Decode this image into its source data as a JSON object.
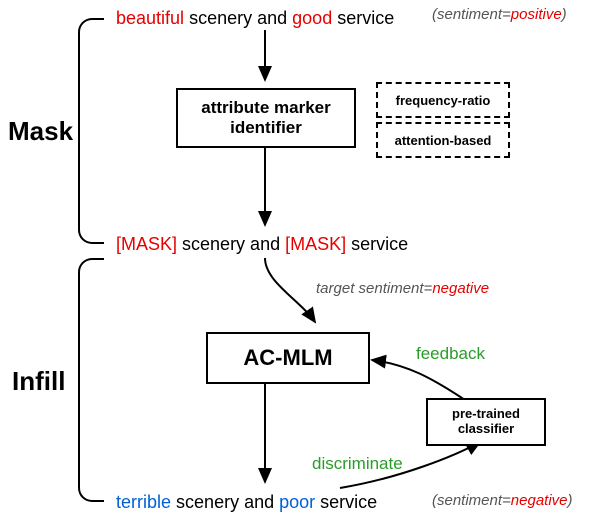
{
  "stages": {
    "mask": "Mask",
    "infill": "Infill"
  },
  "input_sentence": {
    "w0": "beautiful",
    "w1": "scenery and",
    "w2": "good",
    "w3": "service",
    "label_prefix": "(sentiment=",
    "label_value": "positive",
    "label_suffix": ")"
  },
  "marker_box": {
    "line1": "attribute marker",
    "line2": "identifier"
  },
  "marker_methods": {
    "freq": "frequency-ratio",
    "attn": "attention-based"
  },
  "masked_sentence": {
    "m0": "[MASK]",
    "w1": "scenery and",
    "m1": "[MASK]",
    "w3": "service"
  },
  "target_label": {
    "prefix": "target sentiment=",
    "value": "negative"
  },
  "model_box": "AC-MLM",
  "classifier_box": {
    "line1": "pre-trained",
    "line2": "classifier"
  },
  "edges": {
    "feedback": "feedback",
    "discriminate": "discriminate"
  },
  "output_sentence": {
    "w0": "terrible",
    "w1": "scenery and",
    "w2": "poor",
    "w3": "service",
    "label_prefix": "(sentiment=",
    "label_value": "negative",
    "label_suffix": ")"
  }
}
